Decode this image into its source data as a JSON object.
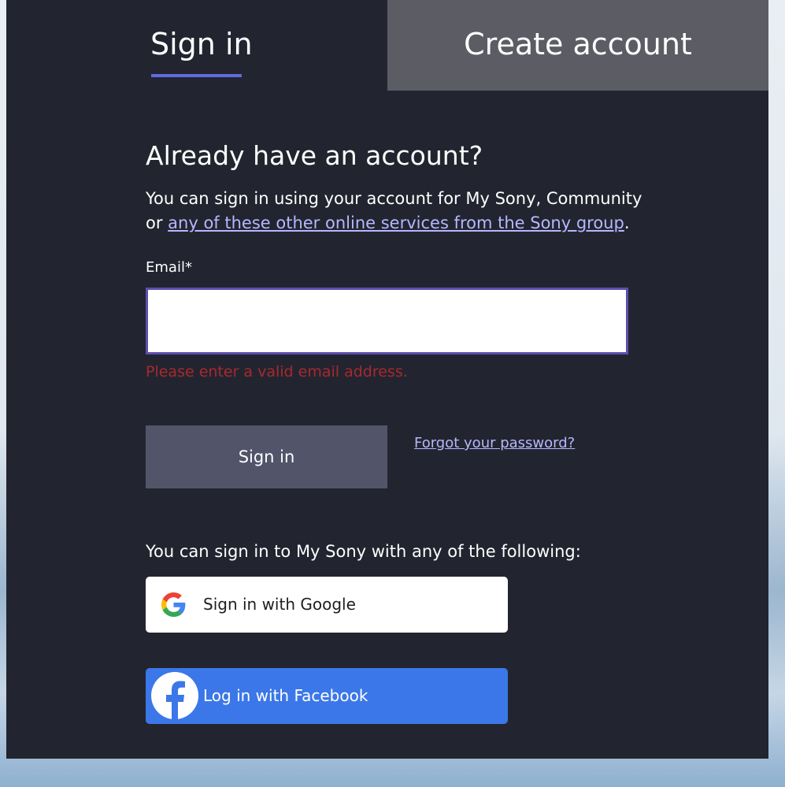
{
  "tabs": {
    "signin_label": "Sign in",
    "create_label": "Create account"
  },
  "form": {
    "heading": "Already have an account?",
    "intro_text": "You can sign in using your account for My Sony, Community or ",
    "intro_link": "any of these other online services from the Sony group",
    "intro_end": ".",
    "email_label": "Email*",
    "email_value": "",
    "email_error": "Please enter a valid email address.",
    "signin_button": "Sign in",
    "forgot_link": "Forgot your password?"
  },
  "social": {
    "intro": "You can sign in to My Sony with any of the following:",
    "google_label": "Sign in with Google",
    "facebook_label": "Log in with Facebook"
  },
  "colors": {
    "panel_bg": "#22252f",
    "create_tab_bg": "#5b5c64",
    "tab_underline": "#5f6be0",
    "link": "#b7b6ff",
    "error": "#a9282f",
    "signin_button_bg": "#52546a",
    "facebook_blue": "#3b77e8"
  }
}
